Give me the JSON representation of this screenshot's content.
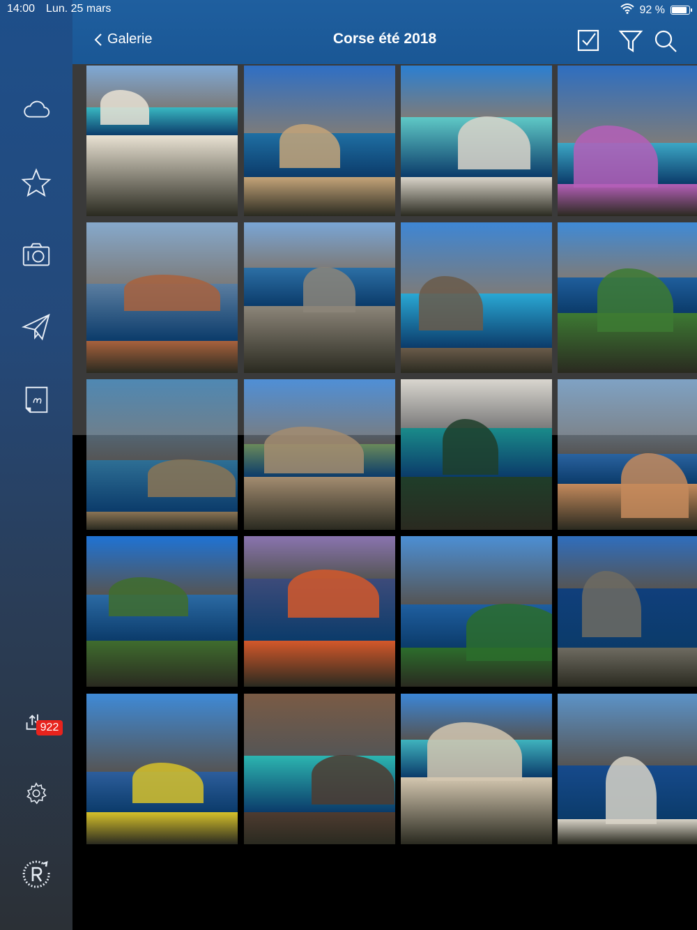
{
  "status": {
    "time": "14:00",
    "date": "Lun. 25 mars",
    "battery": "92 %",
    "battery_level": 0.92
  },
  "header": {
    "back_label": "Galerie",
    "title": "Corse été 2018"
  },
  "sidebar": {
    "badge_count": "922"
  },
  "colors": {
    "sidebar_top": "#1e4f8a",
    "header": "#1a5795",
    "badge": "#e8231d"
  },
  "icons": {
    "sidebar": [
      "cloud-icon",
      "star-icon",
      "camera-icon",
      "send-icon",
      "note-icon",
      "transfer-icon",
      "gear-icon",
      "refresh-logo-icon"
    ],
    "header": [
      "select-checkbox-icon",
      "filter-icon",
      "search-icon"
    ]
  },
  "photos": [
    {
      "sky": "#7fa9d6",
      "sea": "#39b8c2",
      "land": "#e9e2d3",
      "kind": "beach"
    },
    {
      "sky": "#2f6fc4",
      "sea": "#1f6fa3",
      "land": "#c4a479",
      "kind": "citadel"
    },
    {
      "sky": "#2b7fd1",
      "sea": "#5fc9c6",
      "land": "#d9d4c9",
      "kind": "boats"
    },
    {
      "sky": "#2e6ec0",
      "sea": "#3ca7c5",
      "land": "#b45fb8",
      "kind": "flowers"
    },
    {
      "sky": "#86a9cc",
      "sea": "#5b7ea1",
      "land": "#a8623d",
      "kind": "rocks"
    },
    {
      "sky": "#7aa6d6",
      "sea": "#2c6fa5",
      "land": "#8c8579",
      "kind": "tower"
    },
    {
      "sky": "#3e86d4",
      "sea": "#2aa8d4",
      "land": "#6a5b4a",
      "kind": "pool"
    },
    {
      "sky": "#3f8ad6",
      "sea": "#1f5e9c",
      "land": "#3d7a33",
      "kind": "coast"
    },
    {
      "sky": "#4f88b3",
      "sea": "#2e6f95",
      "land": "#8a7455",
      "kind": "village"
    },
    {
      "sky": "#4f8fd6",
      "sea": "#6a8a5a",
      "land": "#a38c70",
      "kind": "houses"
    },
    {
      "sky": "#d9d6cf",
      "sea": "#1a8b8a",
      "land": "#1f3e2a",
      "kind": "cave"
    },
    {
      "sky": "#7fa2c4",
      "sea": "#2a63a0",
      "land": "#c48a5c",
      "kind": "town"
    },
    {
      "sky": "#1f73d4",
      "sea": "#2b6aa4",
      "land": "#3f6d2e",
      "kind": "hills"
    },
    {
      "sky": "#8a74b0",
      "sea": "#3d4b7a",
      "land": "#d4582a",
      "kind": "cliff"
    },
    {
      "sky": "#4c8fd4",
      "sea": "#1f5fa0",
      "land": "#2c6d2c",
      "kind": "bay"
    },
    {
      "sky": "#2f6ebe",
      "sea": "#103f7c",
      "land": "#6e6b61",
      "kind": "islands"
    },
    {
      "sky": "#3f8ad6",
      "sea": "#2d5e9c",
      "land": "#d6c12a",
      "kind": "meadow"
    },
    {
      "sky": "#7a5b45",
      "sea": "#2cb5b0",
      "land": "#4e3b30",
      "kind": "cove"
    },
    {
      "sky": "#3b86d6",
      "sea": "#3fb3be",
      "land": "#d4c7b0",
      "kind": "lagoon"
    },
    {
      "sky": "#5c93c8",
      "sea": "#164a8c",
      "land": "#d8d3c7",
      "kind": "whitecliffs"
    }
  ]
}
